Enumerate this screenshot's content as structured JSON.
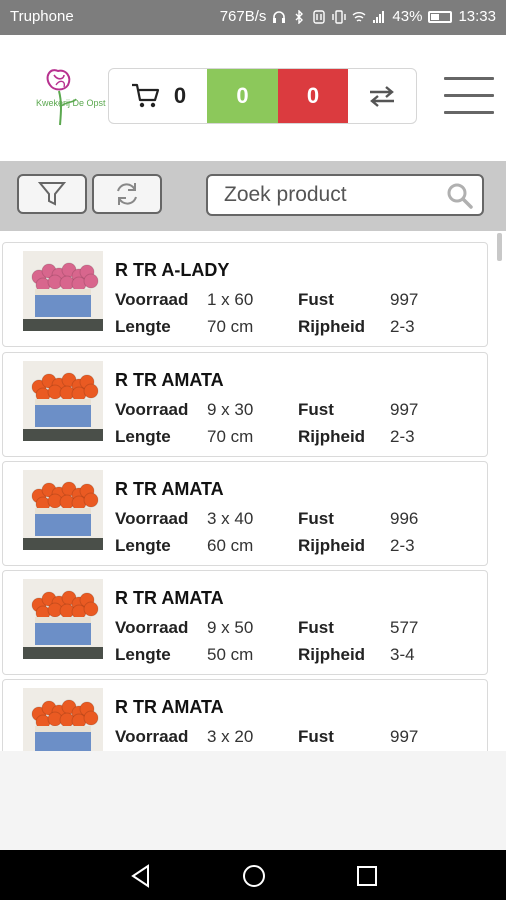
{
  "status": {
    "carrier": "Truphone",
    "speed": "767B/s",
    "battery": "43%",
    "time": "13:33"
  },
  "header": {
    "logo_text": "Kwekerij De Opst",
    "cart_count": "0",
    "green_count": "0",
    "red_count": "0"
  },
  "search": {
    "placeholder": "Zoek product"
  },
  "labels": {
    "voorraad": "Voorraad",
    "lengte": "Lengte",
    "fust": "Fust",
    "rijpheid": "Rijpheid"
  },
  "products": [
    {
      "name": "R TR A-LADY",
      "voorraad": "1 x 60",
      "lengte": "70 cm",
      "fust": "997",
      "rijpheid": "2-3",
      "flower_color": "#d8668d"
    },
    {
      "name": "R TR AMATA",
      "voorraad": "9 x 30",
      "lengte": "70 cm",
      "fust": "997",
      "rijpheid": "2-3",
      "flower_color": "#ea5a22"
    },
    {
      "name": "R TR AMATA",
      "voorraad": "3 x 40",
      "lengte": "60 cm",
      "fust": "996",
      "rijpheid": "2-3",
      "flower_color": "#ea5a22"
    },
    {
      "name": "R TR AMATA",
      "voorraad": "9 x 50",
      "lengte": "50 cm",
      "fust": "577",
      "rijpheid": "3-4",
      "flower_color": "#ea5a22"
    },
    {
      "name": "R TR AMATA",
      "voorraad": "3 x 20",
      "lengte": "",
      "fust": "997",
      "rijpheid": "",
      "flower_color": "#ea5a22"
    }
  ],
  "colors": {
    "green": "#8cc85b",
    "red": "#db3b3f",
    "filter_bar": "#c9c9c9"
  }
}
